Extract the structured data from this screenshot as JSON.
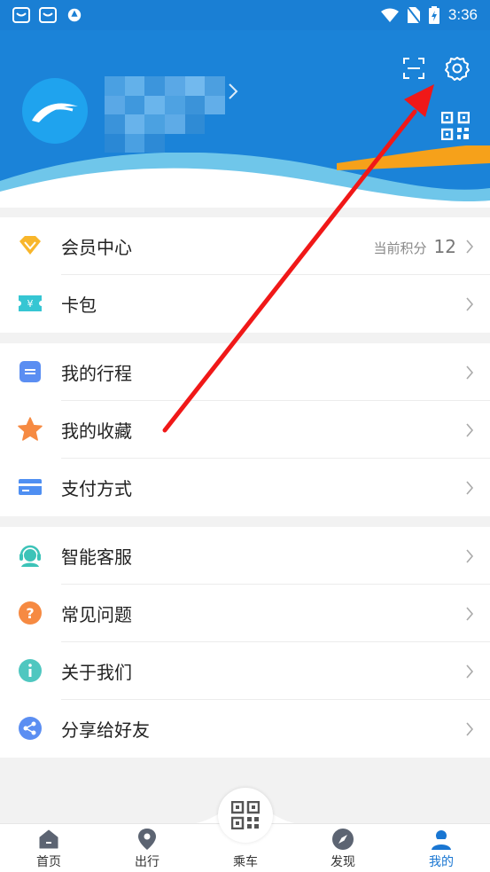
{
  "status_bar": {
    "time": "3:36"
  },
  "header": {
    "bg_color": "#1b83d8"
  },
  "member": {
    "label": "会员中心",
    "points_label": "当前积分",
    "points": "12"
  },
  "card_pack": {
    "label": "卡包"
  },
  "group2": [
    {
      "label": "我的行程",
      "icon": "itinerary-icon"
    },
    {
      "label": "我的收藏",
      "icon": "star-icon"
    },
    {
      "label": "支付方式",
      "icon": "payment-card-icon"
    }
  ],
  "group3": [
    {
      "label": "智能客服",
      "icon": "customer-service-icon"
    },
    {
      "label": "常见问题",
      "icon": "question-icon"
    },
    {
      "label": "关于我们",
      "icon": "info-icon"
    },
    {
      "label": "分享给好友",
      "icon": "share-icon"
    }
  ],
  "bottom_nav": {
    "home": "首页",
    "travel": "出行",
    "ride": "乘车",
    "discover": "发现",
    "mine": "我的"
  },
  "colors": {
    "accent": "#1b83d8",
    "active_tab": "#1976d2",
    "annotation_arrow": "#f01818"
  }
}
